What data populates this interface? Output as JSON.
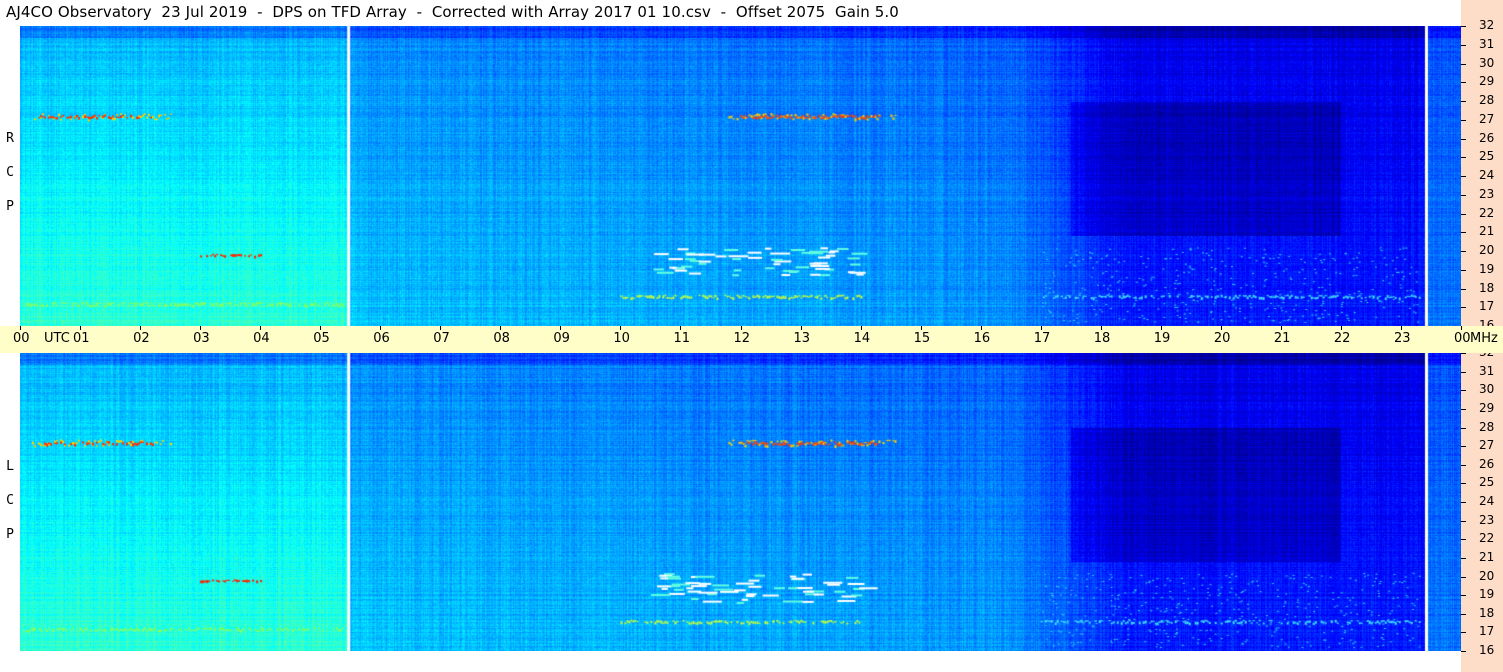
{
  "title": "AJ4CO Observatory  23 Jul 2019  -  DPS on TFD Array  -  Corrected with Array 2017 01 10.csv  -  Offset 2075  Gain 5.0",
  "panels": {
    "upper": {
      "label": "R C P"
    },
    "lower": {
      "label": "L C P"
    }
  },
  "time_axis": {
    "unit_label": "UTC",
    "end_unit_label": "MHz",
    "ticks": [
      "00",
      "01",
      "02",
      "03",
      "04",
      "05",
      "06",
      "07",
      "08",
      "09",
      "10",
      "11",
      "12",
      "13",
      "14",
      "15",
      "16",
      "17",
      "18",
      "19",
      "20",
      "21",
      "22",
      "23",
      "00"
    ]
  },
  "freq_axis": {
    "ticks": [
      "32",
      "31",
      "30",
      "29",
      "28",
      "27",
      "26",
      "25",
      "24",
      "23",
      "22",
      "21",
      "20",
      "19",
      "18",
      "17",
      "16"
    ]
  },
  "colors": {
    "time_axis_bg": "#fffdc8",
    "freq_axis_bg": "#fddcc8",
    "marker": "#ffffff"
  },
  "chart_data": {
    "type": "heatmap",
    "title": "AJ4CO Observatory  23 Jul 2019  -  DPS on TFD Array  -  Corrected with Array 2017 01 10.csv  -  Offset 2075  Gain 5.0",
    "x_range_hours_utc": [
      0,
      24
    ],
    "y_range_mhz": [
      16,
      32
    ],
    "panels": [
      "R C P",
      "L C P"
    ],
    "colormap": "jet",
    "markers_utc_hours": [
      5.45,
      23.4
    ]
  }
}
